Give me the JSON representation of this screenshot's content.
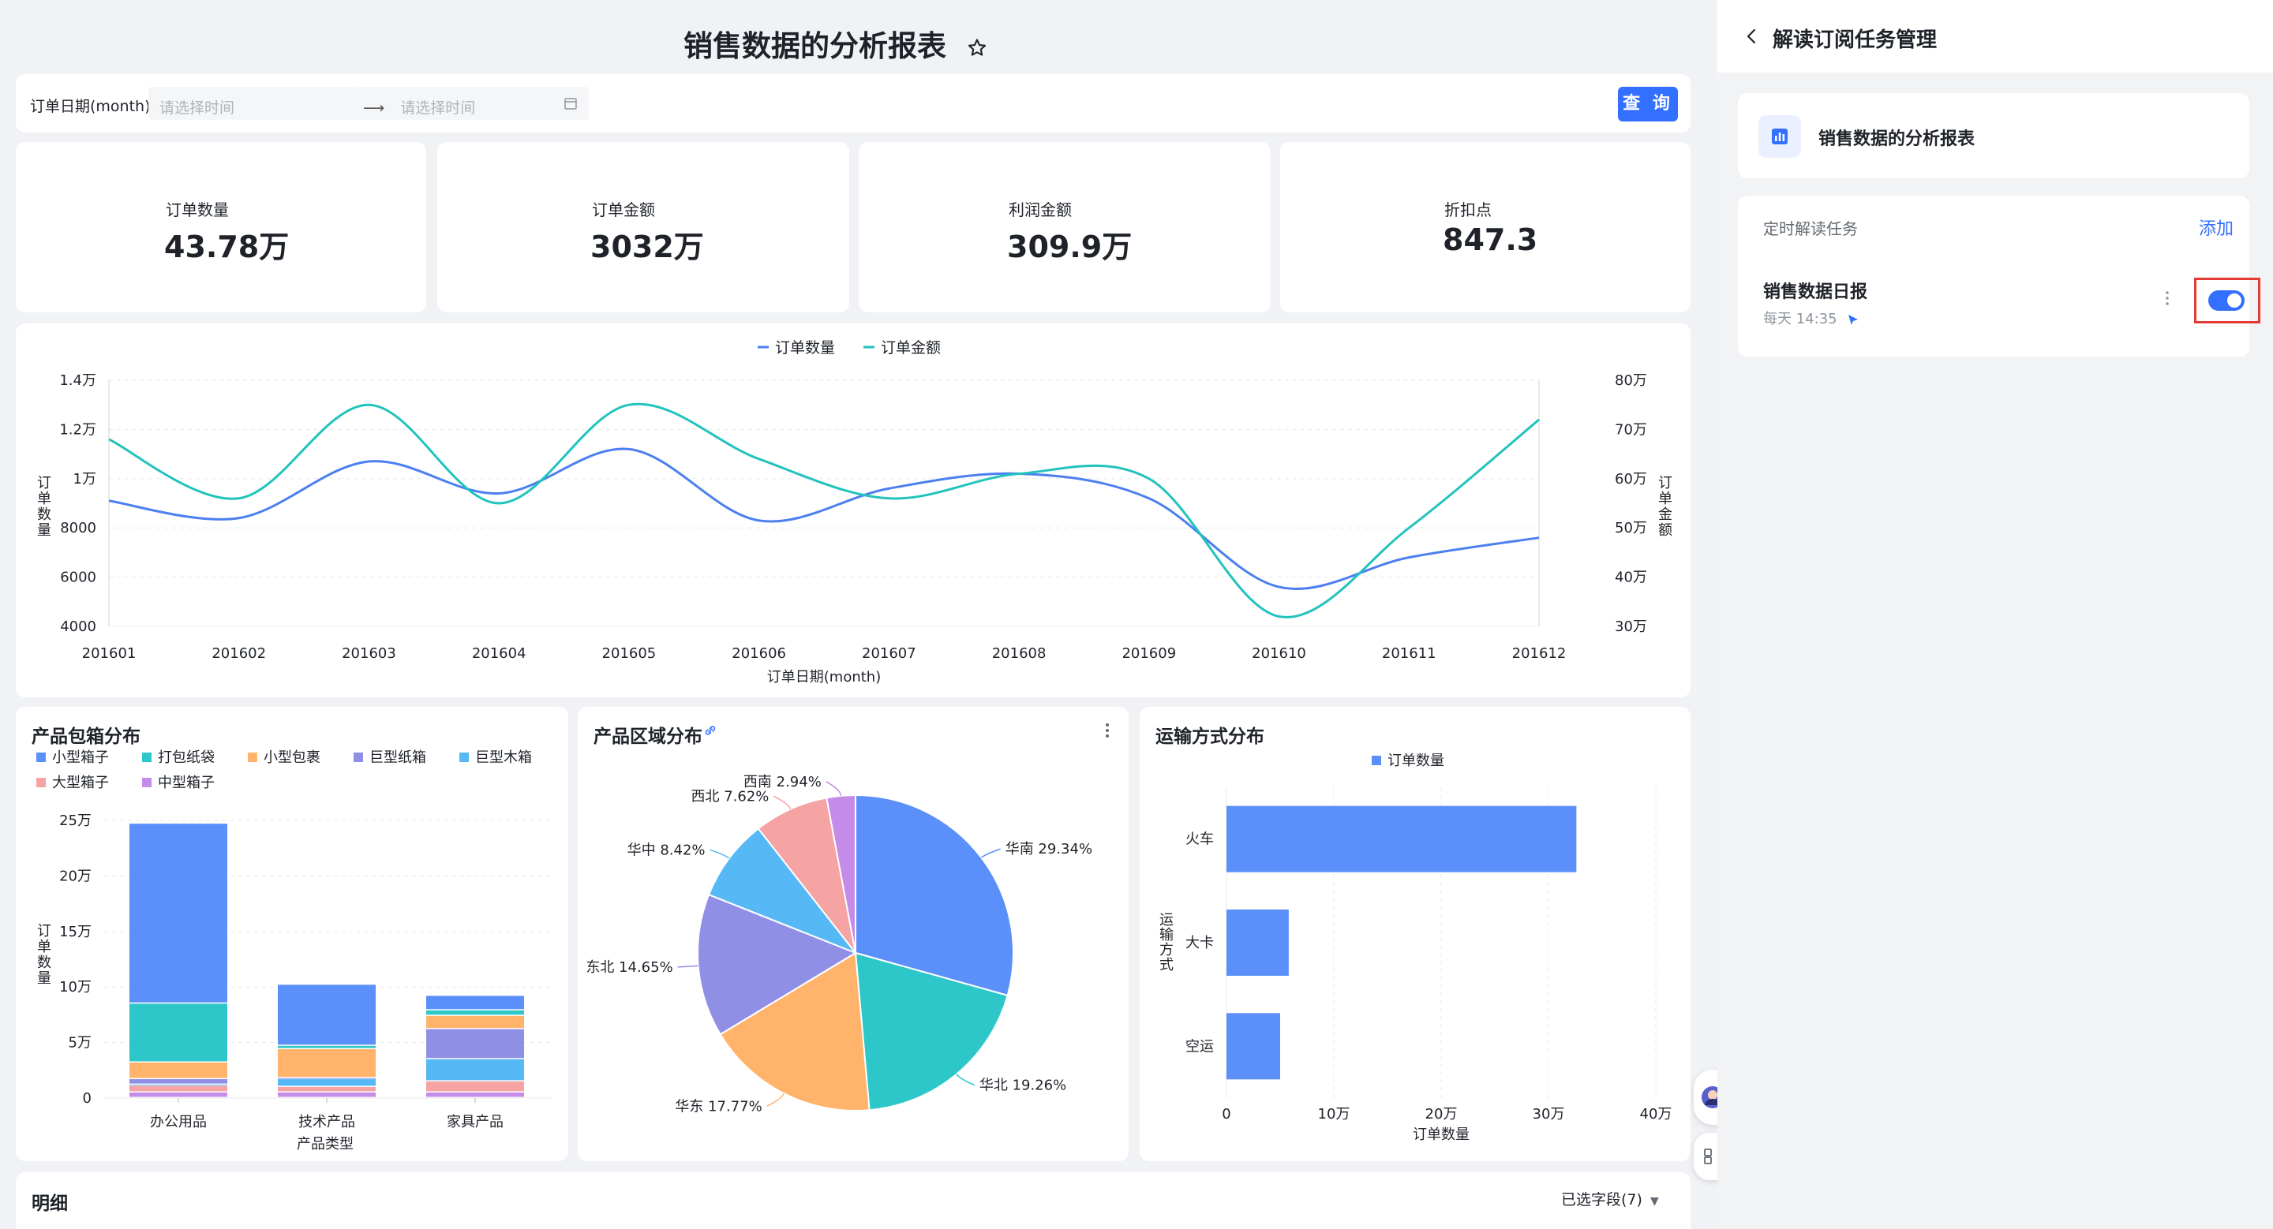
{
  "page_title": "销售数据的分析报表",
  "filter": {
    "label": "订单日期(month)",
    "start_placeholder": "请选择时间",
    "end_placeholder": "请选择时间",
    "query_label": "查 询"
  },
  "kpis": [
    {
      "label": "订单数量",
      "value": "43.78万"
    },
    {
      "label": "订单金额",
      "value": "3032万"
    },
    {
      "label": "利润金额",
      "value": "309.9万"
    },
    {
      "label": "折扣点",
      "value": "847.3"
    }
  ],
  "details": {
    "title": "明细",
    "fields_label": "已选字段(7)"
  },
  "colors": {
    "blue": "#5b8ff9",
    "teal": "#2ec7c9",
    "line_blue": "#4c7ff0",
    "line_teal": "#22c3bd",
    "accent": "#3370ff",
    "highlight": "#e53935"
  },
  "chart_data": [
    {
      "type": "line",
      "x": [
        "201601",
        "201602",
        "201603",
        "201604",
        "201605",
        "201606",
        "201607",
        "201608",
        "201609",
        "201610",
        "201611",
        "201612"
      ],
      "xlabel": "订单日期(month)",
      "ylabel": "订单数量",
      "ylabel_right": "订单金额",
      "yticks": [
        "4000",
        "6000",
        "8000",
        "1万",
        "1.2万",
        "1.4万"
      ],
      "yticks_right": [
        "30万",
        "40万",
        "50万",
        "60万",
        "70万",
        "80万"
      ],
      "ylim": [
        4000,
        14000
      ],
      "ylim_right": [
        300000,
        800000
      ],
      "series": [
        {
          "name": "订单数量",
          "axis": "left",
          "values": [
            9100,
            8400,
            10700,
            9400,
            11200,
            8300,
            9600,
            10200,
            9200,
            5600,
            6800,
            7600
          ]
        },
        {
          "name": "订单金额",
          "axis": "right",
          "values": [
            680000,
            560000,
            750000,
            550000,
            750000,
            640000,
            560000,
            610000,
            600000,
            320000,
            500000,
            720000
          ]
        }
      ],
      "grid": true,
      "legend_position": "top-center"
    },
    {
      "type": "bar",
      "stacked": true,
      "title": "产品包箱分布",
      "categories": [
        "办公用品",
        "技术产品",
        "家具产品"
      ],
      "xlabel": "产品类型",
      "ylabel": "订单数量",
      "yticks": [
        "0",
        "5万",
        "10万",
        "15万",
        "20万",
        "25万"
      ],
      "ylim": [
        0,
        250000
      ],
      "series": [
        {
          "name": "小型箱子",
          "color": "#5b8ff9",
          "values": [
            162000,
            55000,
            13000
          ]
        },
        {
          "name": "打包纸袋",
          "color": "#2ec7c9",
          "values": [
            53000,
            3000,
            5000
          ]
        },
        {
          "name": "小型包裹",
          "color": "#ffb36b",
          "values": [
            15000,
            26000,
            12000
          ]
        },
        {
          "name": "巨型纸箱",
          "color": "#8f8fe6",
          "values": [
            5000,
            1000,
            27000
          ]
        },
        {
          "name": "巨型木箱",
          "color": "#56b8f5",
          "values": [
            1000,
            7000,
            20000
          ]
        },
        {
          "name": "大型箱子",
          "color": "#f5a3a3",
          "values": [
            6000,
            5000,
            10000
          ]
        },
        {
          "name": "中型箱子",
          "color": "#c58be8",
          "values": [
            5000,
            5000,
            5000
          ]
        }
      ],
      "legend_position": "top-left"
    },
    {
      "type": "pie",
      "title": "产品区域分布",
      "slices": [
        {
          "label": "华南 29.34%",
          "value": 29.34,
          "color": "#5b8ff9"
        },
        {
          "label": "华北 19.26%",
          "value": 19.26,
          "color": "#2ec7c9"
        },
        {
          "label": "华东 17.77%",
          "value": 17.77,
          "color": "#ffb36b"
        },
        {
          "label": "东北 14.65%",
          "value": 14.65,
          "color": "#8f8fe6"
        },
        {
          "label": "华中 8.42%",
          "value": 8.42,
          "color": "#56b8f5"
        },
        {
          "label": "西北 7.62%",
          "value": 7.62,
          "color": "#f5a3a3"
        },
        {
          "label": "西南 2.94%",
          "value": 2.94,
          "color": "#c58be8"
        }
      ]
    },
    {
      "type": "bar",
      "orientation": "horizontal",
      "title": "运输方式分布",
      "categories": [
        "火车",
        "大卡",
        "空运"
      ],
      "ylabel": "运输方式",
      "xlabel": "订单数量",
      "xticks": [
        "0",
        "10万",
        "20万",
        "30万",
        "40万"
      ],
      "xlim": [
        0,
        400000
      ],
      "series": [
        {
          "name": "订单数量",
          "color": "#5b8ff9",
          "values": [
            326000,
            58000,
            50000
          ]
        }
      ],
      "legend_position": "top-center"
    }
  ],
  "right_panel": {
    "title": "解读订阅任务管理",
    "report_name": "销售数据的分析报表",
    "section_label": "定时解读任务",
    "add_label": "添加",
    "task": {
      "name": "销售数据日报",
      "schedule": "每天 14:35",
      "enabled": true
    }
  }
}
